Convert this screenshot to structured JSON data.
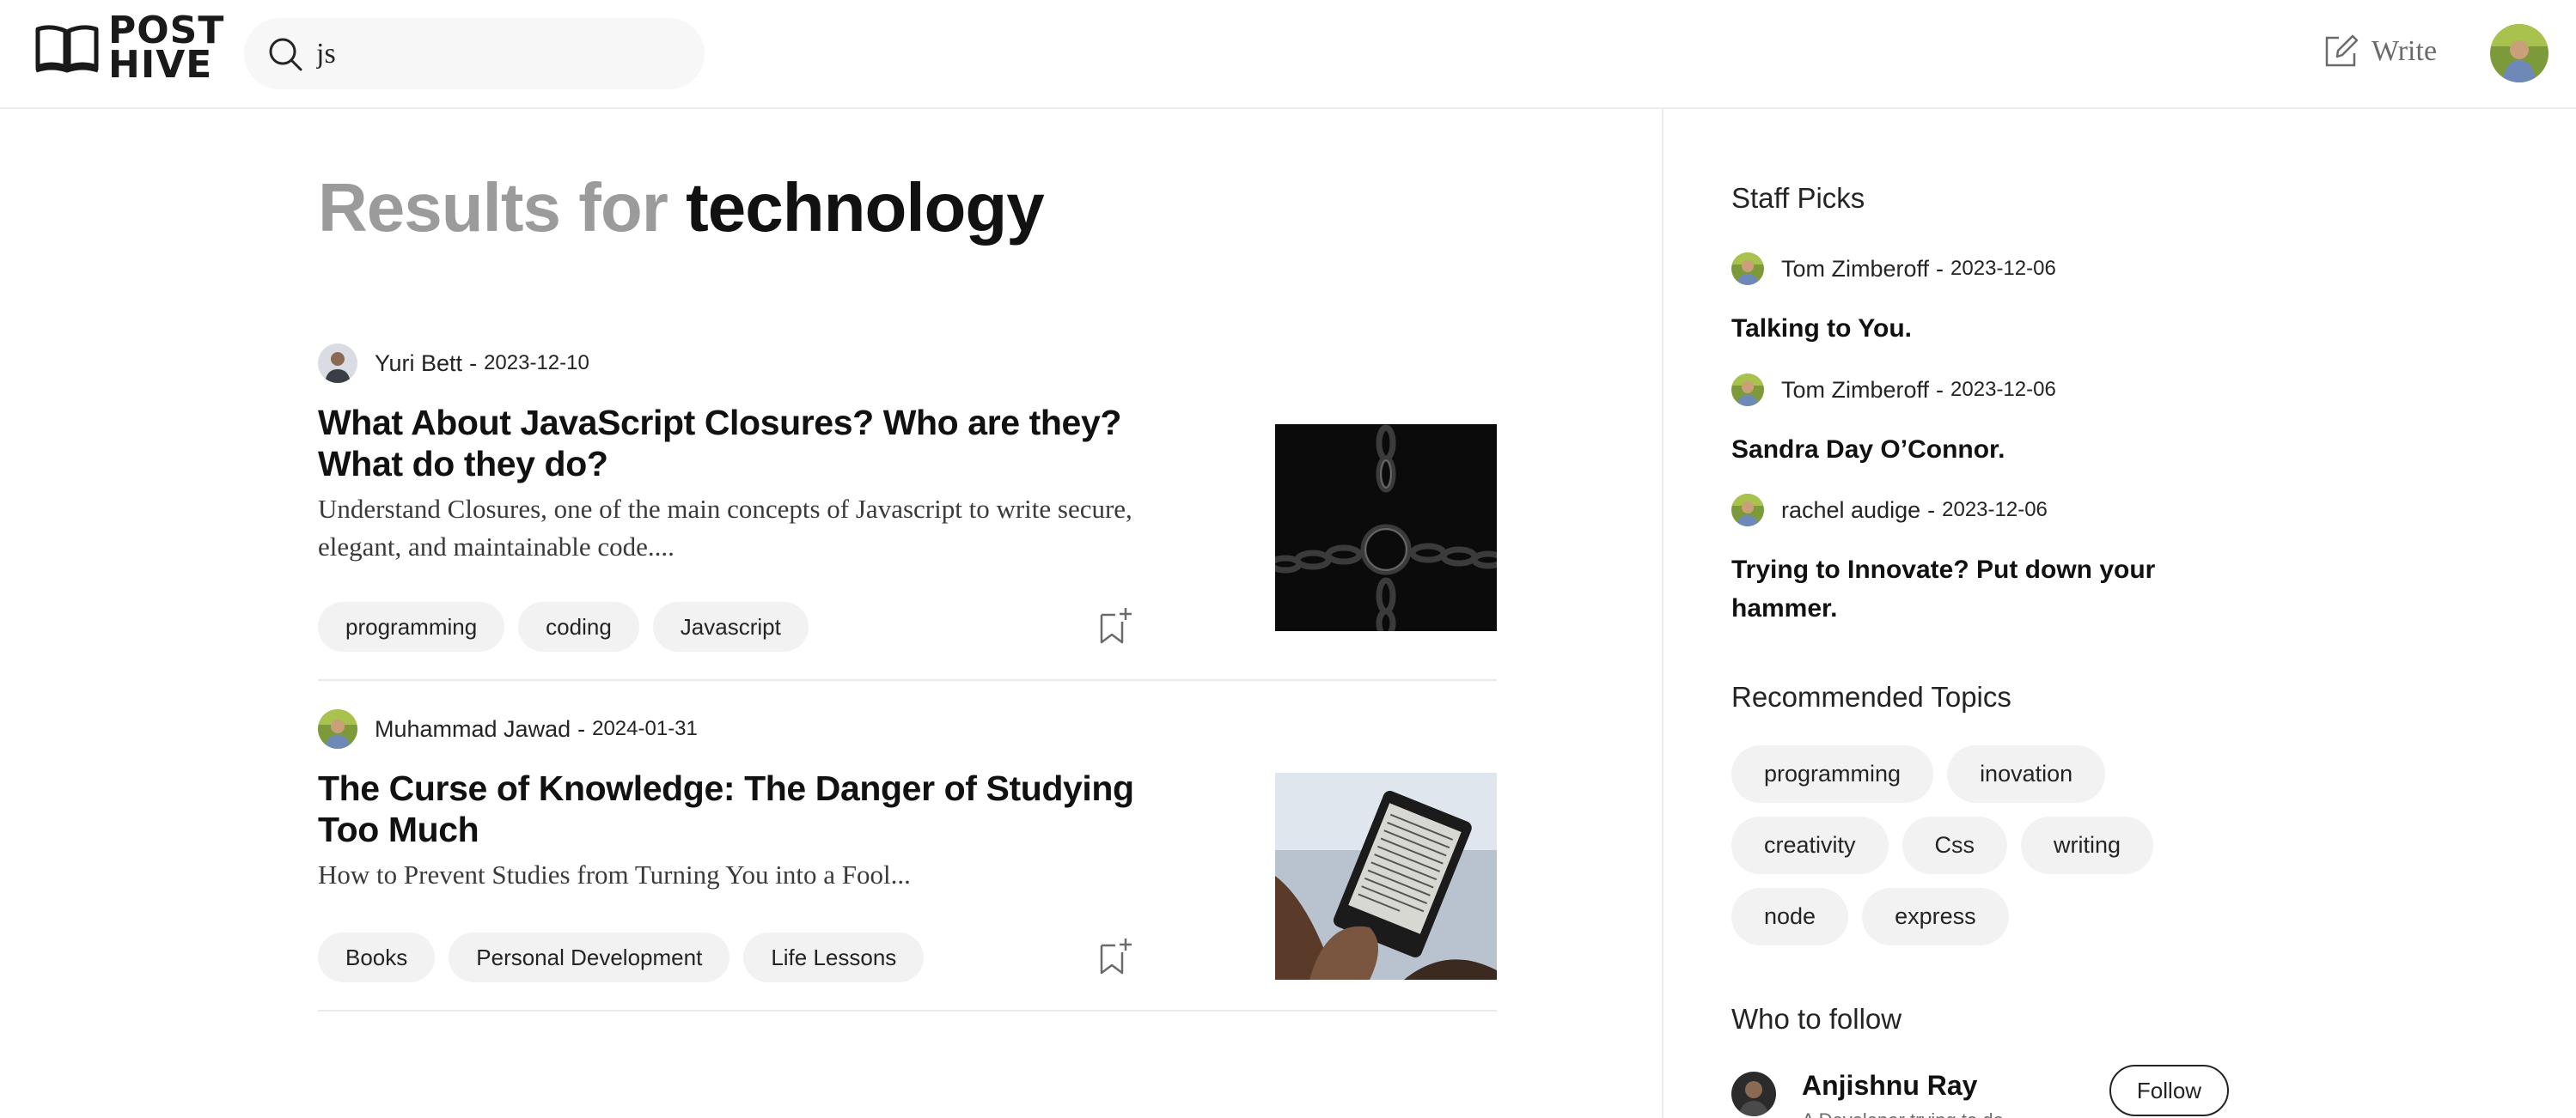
{
  "header": {
    "logo_line1": "POST",
    "logo_line2": "HIVE",
    "search_value": "js",
    "write_label": "Write"
  },
  "results": {
    "prefix": "Results for",
    "query": "technology"
  },
  "articles": [
    {
      "author": "Yuri Bett",
      "separator": "-",
      "date": "2023-12-10",
      "title": "What About JavaScript Closures? Who are they? What do they do?",
      "description": "Understand Closures, one of the main concepts of Javascript to write secure, elegant, and maintainable code....",
      "tags": [
        "programming",
        "coding",
        "Javascript"
      ]
    },
    {
      "author": "Muhammad Jawad",
      "separator": "-",
      "date": "2024-01-31",
      "title": "The Curse of Knowledge: The Danger of Studying Too Much",
      "description": "How to Prevent Studies from Turning You into a Fool...",
      "tags": [
        "Books",
        "Personal Development",
        "Life Lessons"
      ]
    }
  ],
  "sidebar": {
    "staff_picks_heading": "Staff Picks",
    "picks": [
      {
        "author": "Tom Zimberoff",
        "separator": "-",
        "date": "2023-12-06",
        "title": "Talking to You."
      },
      {
        "author": "Tom Zimberoff",
        "separator": "-",
        "date": "2023-12-06",
        "title": "Sandra Day O’Connor."
      },
      {
        "author": "rachel audige",
        "separator": "-",
        "date": "2023-12-06",
        "title": "Trying to Innovate? Put down your hammer."
      }
    ],
    "topics_heading": "Recommended Topics",
    "topics": [
      "programming",
      "inovation",
      "creativity",
      "Css",
      "writing",
      "node",
      "express"
    ],
    "follow_heading": "Who to follow",
    "follow": {
      "name": "Anjishnu Ray",
      "button_label": "Follow",
      "subtitle": "A Developer trying to do..."
    }
  },
  "colors": {
    "accent_text": "#242424",
    "muted_text": "#9b9b9b",
    "tag_bg": "#f2f2f2",
    "divider": "#ececec"
  },
  "icons": {
    "logo": "open-book-icon",
    "search": "search-icon",
    "write": "write-icon",
    "bookmark": "bookmark-add-icon"
  }
}
